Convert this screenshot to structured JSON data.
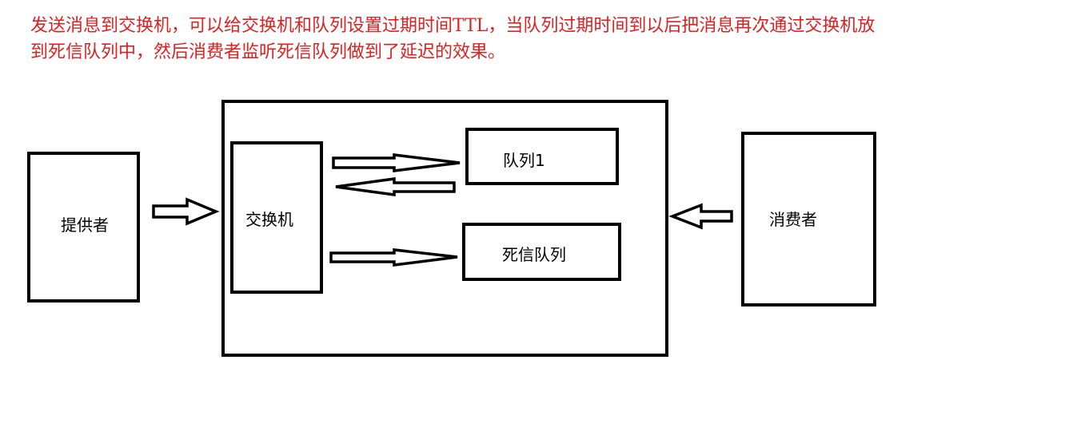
{
  "caption": {
    "line1": "发送消息到交换机，可以给交换机和队列设置过期时间TTL，当队列过期时间到以后把消息再次通过交换机放",
    "line2": "到死信队列中，然后消费者监听死信队列做到了延迟的效果。",
    "color": "#e02020"
  },
  "nodes": {
    "provider": "提供者",
    "exchange": "交换机",
    "queue1": "队列1",
    "dead_letter_queue": "死信队列",
    "consumer": "消费者"
  },
  "colors": {
    "stroke": "#000000",
    "background": "#ffffff"
  }
}
